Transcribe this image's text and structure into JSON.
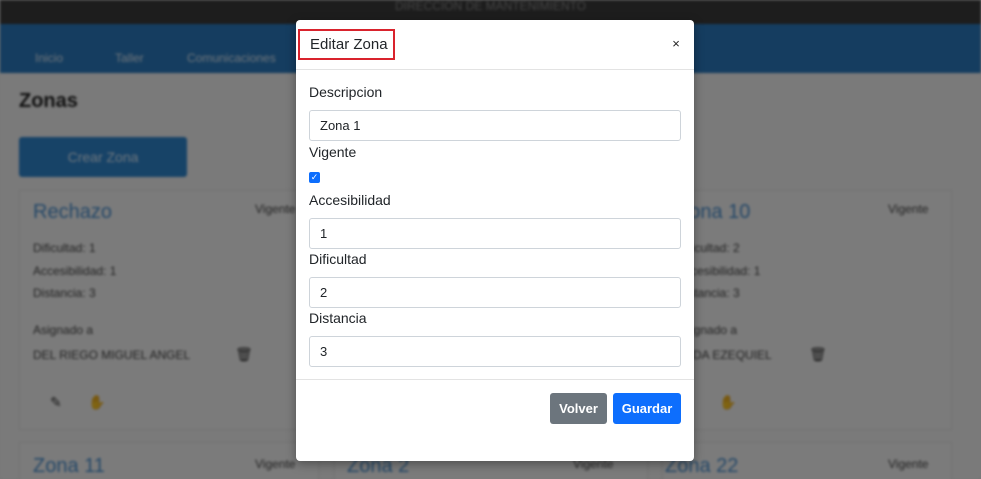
{
  "background": {
    "top_strip_text": "DIRECCION DE MANTENIMIENTO",
    "nav": [
      "Inicio",
      "Taller",
      "Comunicaciones"
    ],
    "page_title": "Zonas",
    "create_button": "Crear Zona",
    "cards": [
      {
        "title": "Rechazo",
        "status": "Vigente",
        "lines": [
          "Dificultad: 1",
          "Accesibilidad: 1",
          "Distancia: 3"
        ],
        "assigned_label": "Asignado a",
        "assigned": "DEL RIEGO MIGUEL ANGEL"
      },
      {
        "title": "Zona 10",
        "status": "Vigente",
        "lines": [
          "Dificultad: 2",
          "Accesibilidad: 1",
          "Distancia: 3"
        ],
        "assigned_label": "Asignado a",
        "assigned": "VEDA EZEQUIEL"
      },
      {
        "title": "Zona 11",
        "status": "Vigente"
      },
      {
        "title": "Zona 2",
        "status": "Vigente"
      },
      {
        "title": "Zona 22",
        "status": "Vigente"
      }
    ]
  },
  "modal": {
    "title": "Editar Zona",
    "close_symbol": "×",
    "fields": {
      "descripcion": {
        "label": "Descripcion",
        "value": "Zona 1"
      },
      "vigente": {
        "label": "Vigente",
        "checked": true
      },
      "accesibilidad": {
        "label": "Accesibilidad",
        "value": "1"
      },
      "dificultad": {
        "label": "Dificultad",
        "value": "2"
      },
      "distancia": {
        "label": "Distancia",
        "value": "3"
      }
    },
    "buttons": {
      "back": "Volver",
      "save": "Guardar"
    }
  },
  "colors": {
    "primary": "#0d6efd",
    "secondary": "#6c757d",
    "highlight_border": "#d9232d",
    "navbar": "#2b7bc0"
  }
}
